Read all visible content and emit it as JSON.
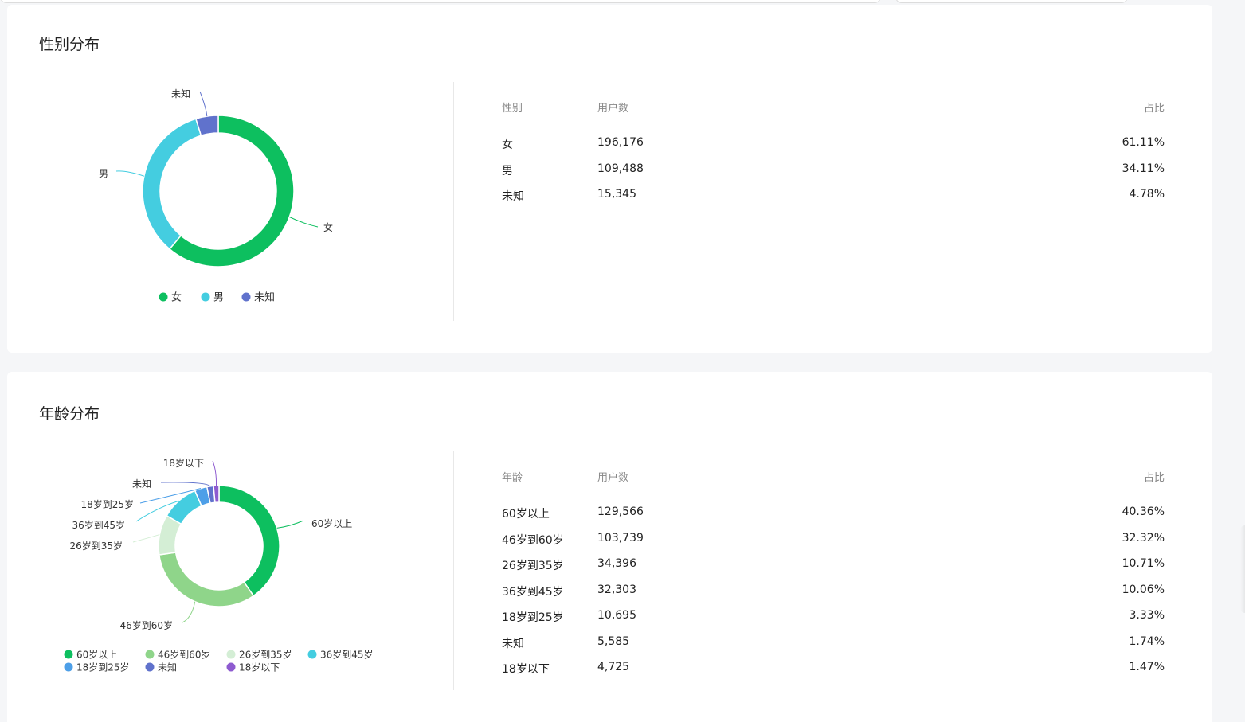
{
  "gender": {
    "title": "性别分布",
    "columns": [
      "性别",
      "用户数",
      "占比"
    ],
    "rows": [
      {
        "label": "女",
        "users": "196,176",
        "pct": "61.11%"
      },
      {
        "label": "男",
        "users": "109,488",
        "pct": "34.11%"
      },
      {
        "label": "未知",
        "users": "15,345",
        "pct": "4.78%"
      }
    ],
    "legend": [
      "女",
      "男",
      "未知"
    ]
  },
  "age": {
    "title": "年龄分布",
    "columns": [
      "年龄",
      "用户数",
      "占比"
    ],
    "rows": [
      {
        "label": "60岁以上",
        "users": "129,566",
        "pct": "40.36%"
      },
      {
        "label": "46岁到60岁",
        "users": "103,739",
        "pct": "32.32%"
      },
      {
        "label": "26岁到35岁",
        "users": "34,396",
        "pct": "10.71%"
      },
      {
        "label": "36岁到45岁",
        "users": "32,303",
        "pct": "10.06%"
      },
      {
        "label": "18岁到25岁",
        "users": "10,695",
        "pct": "3.33%"
      },
      {
        "label": "未知",
        "users": "5,585",
        "pct": "1.74%"
      },
      {
        "label": "18岁以下",
        "users": "4,725",
        "pct": "1.47%"
      }
    ],
    "legend": [
      "60岁以上",
      "46岁到60岁",
      "26岁到35岁",
      "36岁到45岁",
      "18岁到25岁",
      "未知",
      "18岁以下"
    ]
  },
  "chart_data": [
    {
      "type": "pie",
      "title": "性别分布",
      "categories": [
        "女",
        "男",
        "未知"
      ],
      "values": [
        61.11,
        34.11,
        4.78
      ],
      "colors": [
        "#0dbf5f",
        "#44cde0",
        "#6072cc"
      ],
      "legend_position": "bottom"
    },
    {
      "type": "pie",
      "title": "年龄分布",
      "categories": [
        "60岁以上",
        "46岁到60岁",
        "26岁到35岁",
        "36岁到45岁",
        "18岁到25岁",
        "未知",
        "18岁以下"
      ],
      "values": [
        40.36,
        32.32,
        10.71,
        10.06,
        3.33,
        1.74,
        1.47
      ],
      "colors": [
        "#0dbf5f",
        "#8fd58a",
        "#d4eed5",
        "#44cde0",
        "#4d9fe8",
        "#6072cc",
        "#8e5bd0"
      ],
      "legend_position": "bottom"
    }
  ]
}
